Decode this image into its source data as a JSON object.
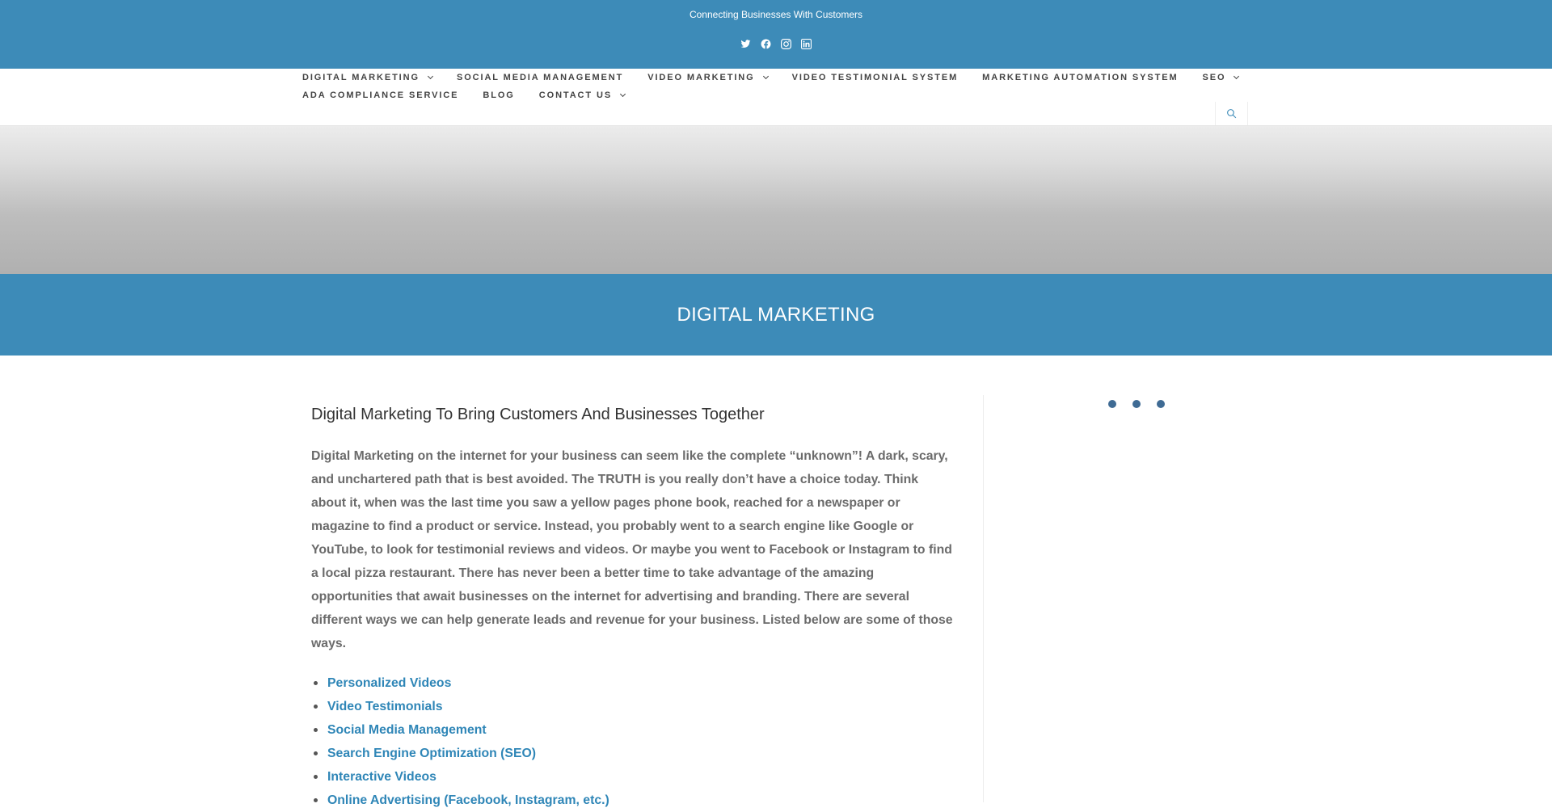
{
  "header": {
    "tagline": "Connecting Businesses With Customers",
    "socials": [
      "twitter-icon",
      "facebook-icon",
      "instagram-icon",
      "linkedin-icon"
    ]
  },
  "nav": {
    "row1": [
      {
        "label": "DIGITAL MARKETING",
        "dropdown": true
      },
      {
        "label": "SOCIAL MEDIA MANAGEMENT",
        "dropdown": false
      },
      {
        "label": "VIDEO MARKETING",
        "dropdown": true
      },
      {
        "label": "VIDEO TESTIMONIAL SYSTEM",
        "dropdown": false
      },
      {
        "label": "MARKETING AUTOMATION SYSTEM",
        "dropdown": false
      },
      {
        "label": "SEO",
        "dropdown": true
      }
    ],
    "row2": [
      {
        "label": "ADA COMPLIANCE SERVICE",
        "dropdown": false
      },
      {
        "label": "BLOG",
        "dropdown": false
      },
      {
        "label": "CONTACT US",
        "dropdown": true
      }
    ]
  },
  "page": {
    "title": "DIGITAL MARKETING"
  },
  "content": {
    "heading": "Digital Marketing To Bring Customers And Businesses Together",
    "paragraph": "Digital Marketing on the internet for your business can seem like the complete “unknown”! A dark, scary, and unchartered path that is best avoided. The TRUTH is you really don’t have a choice today. Think about it, when was the last time you saw a yellow pages phone book, reached for a newspaper or magazine to find a product or service. Instead, you probably went to a search engine like Google or YouTube, to look for testimonial reviews and videos. Or maybe you went to Facebook or Instagram to find a local pizza restaurant. There has never been a better time to take advantage of the amazing opportunities that await businesses on the internet for advertising and branding. There are several different ways we can help generate leads and revenue for your business. Listed below are some of those ways.",
    "links": [
      "Personalized Videos",
      "Video Testimonials",
      "Social Media Management",
      "Search Engine Optimization (SEO)",
      "Interactive Videos",
      "Online Advertising (Facebook, Instagram, etc.)"
    ]
  },
  "colors": {
    "brand": "#3d8bb8",
    "link": "#2f86b7",
    "loader_dot": "#3f6b94"
  }
}
